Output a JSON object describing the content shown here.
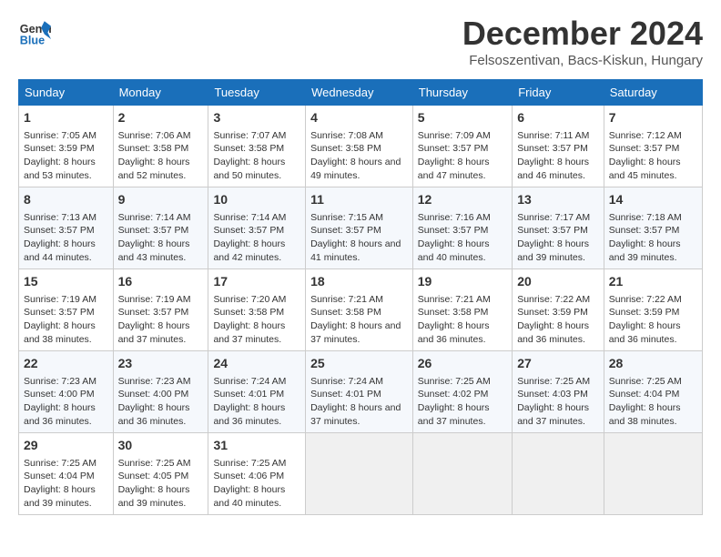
{
  "header": {
    "logo_line1": "General",
    "logo_line2": "Blue",
    "month": "December 2024",
    "location": "Felsoszentivan, Bacs-Kiskun, Hungary"
  },
  "weekdays": [
    "Sunday",
    "Monday",
    "Tuesday",
    "Wednesday",
    "Thursday",
    "Friday",
    "Saturday"
  ],
  "weeks": [
    [
      {
        "day": "1",
        "sunrise": "7:05 AM",
        "sunset": "3:59 PM",
        "daylight": "8 hours and 53 minutes."
      },
      {
        "day": "2",
        "sunrise": "7:06 AM",
        "sunset": "3:58 PM",
        "daylight": "8 hours and 52 minutes."
      },
      {
        "day": "3",
        "sunrise": "7:07 AM",
        "sunset": "3:58 PM",
        "daylight": "8 hours and 50 minutes."
      },
      {
        "day": "4",
        "sunrise": "7:08 AM",
        "sunset": "3:58 PM",
        "daylight": "8 hours and 49 minutes."
      },
      {
        "day": "5",
        "sunrise": "7:09 AM",
        "sunset": "3:57 PM",
        "daylight": "8 hours and 47 minutes."
      },
      {
        "day": "6",
        "sunrise": "7:11 AM",
        "sunset": "3:57 PM",
        "daylight": "8 hours and 46 minutes."
      },
      {
        "day": "7",
        "sunrise": "7:12 AM",
        "sunset": "3:57 PM",
        "daylight": "8 hours and 45 minutes."
      }
    ],
    [
      {
        "day": "8",
        "sunrise": "7:13 AM",
        "sunset": "3:57 PM",
        "daylight": "8 hours and 44 minutes."
      },
      {
        "day": "9",
        "sunrise": "7:14 AM",
        "sunset": "3:57 PM",
        "daylight": "8 hours and 43 minutes."
      },
      {
        "day": "10",
        "sunrise": "7:14 AM",
        "sunset": "3:57 PM",
        "daylight": "8 hours and 42 minutes."
      },
      {
        "day": "11",
        "sunrise": "7:15 AM",
        "sunset": "3:57 PM",
        "daylight": "8 hours and 41 minutes."
      },
      {
        "day": "12",
        "sunrise": "7:16 AM",
        "sunset": "3:57 PM",
        "daylight": "8 hours and 40 minutes."
      },
      {
        "day": "13",
        "sunrise": "7:17 AM",
        "sunset": "3:57 PM",
        "daylight": "8 hours and 39 minutes."
      },
      {
        "day": "14",
        "sunrise": "7:18 AM",
        "sunset": "3:57 PM",
        "daylight": "8 hours and 39 minutes."
      }
    ],
    [
      {
        "day": "15",
        "sunrise": "7:19 AM",
        "sunset": "3:57 PM",
        "daylight": "8 hours and 38 minutes."
      },
      {
        "day": "16",
        "sunrise": "7:19 AM",
        "sunset": "3:57 PM",
        "daylight": "8 hours and 37 minutes."
      },
      {
        "day": "17",
        "sunrise": "7:20 AM",
        "sunset": "3:58 PM",
        "daylight": "8 hours and 37 minutes."
      },
      {
        "day": "18",
        "sunrise": "7:21 AM",
        "sunset": "3:58 PM",
        "daylight": "8 hours and 37 minutes."
      },
      {
        "day": "19",
        "sunrise": "7:21 AM",
        "sunset": "3:58 PM",
        "daylight": "8 hours and 36 minutes."
      },
      {
        "day": "20",
        "sunrise": "7:22 AM",
        "sunset": "3:59 PM",
        "daylight": "8 hours and 36 minutes."
      },
      {
        "day": "21",
        "sunrise": "7:22 AM",
        "sunset": "3:59 PM",
        "daylight": "8 hours and 36 minutes."
      }
    ],
    [
      {
        "day": "22",
        "sunrise": "7:23 AM",
        "sunset": "4:00 PM",
        "daylight": "8 hours and 36 minutes."
      },
      {
        "day": "23",
        "sunrise": "7:23 AM",
        "sunset": "4:00 PM",
        "daylight": "8 hours and 36 minutes."
      },
      {
        "day": "24",
        "sunrise": "7:24 AM",
        "sunset": "4:01 PM",
        "daylight": "8 hours and 36 minutes."
      },
      {
        "day": "25",
        "sunrise": "7:24 AM",
        "sunset": "4:01 PM",
        "daylight": "8 hours and 37 minutes."
      },
      {
        "day": "26",
        "sunrise": "7:25 AM",
        "sunset": "4:02 PM",
        "daylight": "8 hours and 37 minutes."
      },
      {
        "day": "27",
        "sunrise": "7:25 AM",
        "sunset": "4:03 PM",
        "daylight": "8 hours and 37 minutes."
      },
      {
        "day": "28",
        "sunrise": "7:25 AM",
        "sunset": "4:04 PM",
        "daylight": "8 hours and 38 minutes."
      }
    ],
    [
      {
        "day": "29",
        "sunrise": "7:25 AM",
        "sunset": "4:04 PM",
        "daylight": "8 hours and 39 minutes."
      },
      {
        "day": "30",
        "sunrise": "7:25 AM",
        "sunset": "4:05 PM",
        "daylight": "8 hours and 39 minutes."
      },
      {
        "day": "31",
        "sunrise": "7:25 AM",
        "sunset": "4:06 PM",
        "daylight": "8 hours and 40 minutes."
      },
      null,
      null,
      null,
      null
    ]
  ]
}
